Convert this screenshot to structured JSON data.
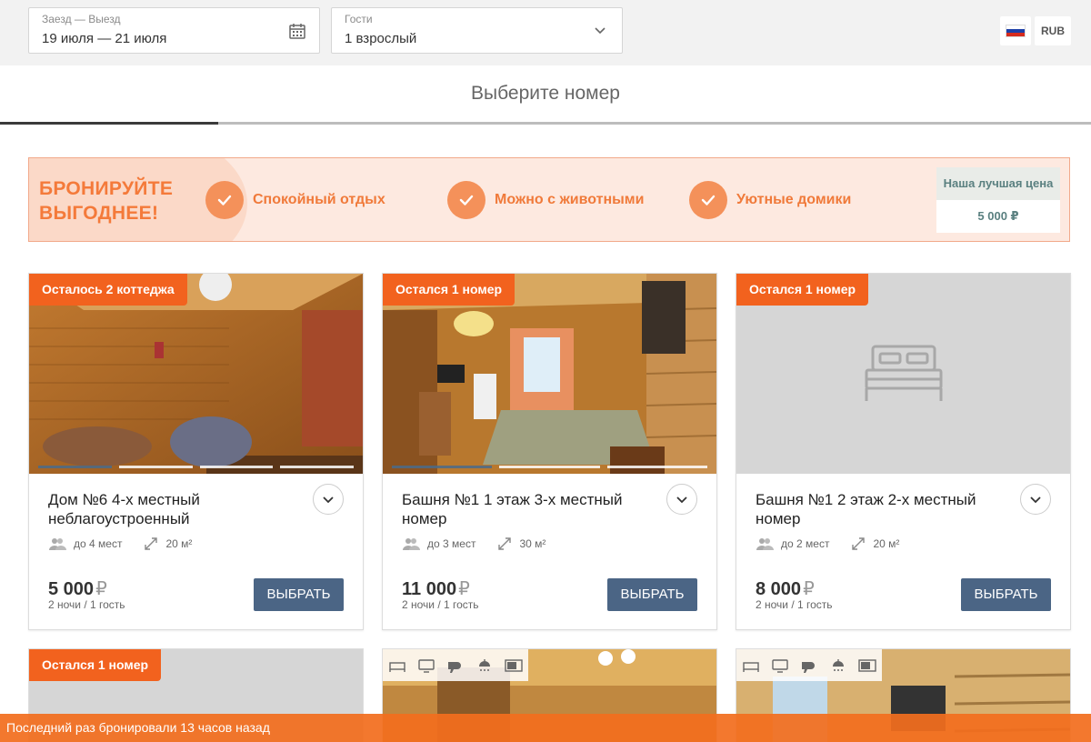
{
  "search": {
    "dates_label": "Заезд — Выезд",
    "dates_value": "19 июля — 21 июля",
    "guests_label": "Гости",
    "guests_value": "1 взрослый",
    "currency": "RUB"
  },
  "step": {
    "title": "Выберите номер",
    "progress_fraction": 0.2
  },
  "promo": {
    "title_line1": "БРОНИРУЙТЕ",
    "title_line2": "ВЫГОДНЕЕ!",
    "features": [
      "Спокойный отдых",
      "Можно с животными",
      "Уютные домики"
    ],
    "best_price_label": "Наша лучшая цена",
    "best_price_value": "5 000 ₽"
  },
  "rooms": [
    {
      "badge": "Осталось 2 коттеджа",
      "title": "Дом №6 4-х местный неблагоустроенный",
      "capacity": "до 4 мест",
      "area": "20 м²",
      "price": "5 000",
      "currency_symbol": "₽",
      "price_note": "2 ночи / 1 гость",
      "select_label": "ВЫБРАТЬ",
      "photo": "wood-cabin-two-beds"
    },
    {
      "badge": "Остался 1 номер",
      "title": "Башня №1 1 этаж 3-х местный номер",
      "capacity": "до 3 мест",
      "area": "30 м²",
      "price": "11 000",
      "currency_symbol": "₽",
      "price_note": "2 ночи / 1 гость",
      "select_label": "ВЫБРАТЬ",
      "photo": "log-room-double-bed"
    },
    {
      "badge": "Остался 1 номер",
      "title": "Башня №1 2 этаж 2-х местный номер",
      "capacity": "до 2 мест",
      "area": "20 м²",
      "price": "8 000",
      "currency_symbol": "₽",
      "price_note": "2 ночи / 1 гость",
      "select_label": "ВЫБРАТЬ",
      "photo": "placeholder-bed-icon"
    }
  ],
  "next_row": {
    "badge": "Остался 1 номер",
    "amenity_icons": [
      "bed-icon",
      "tv-icon",
      "hair-dryer-icon",
      "shower-icon",
      "microwave-icon"
    ]
  },
  "toast": {
    "text": "Последний раз бронировали 13 часов назад"
  },
  "colors": {
    "accent_orange": "#f2621e",
    "button_blue": "#4b6585",
    "promo_bg": "#fde9e0"
  }
}
